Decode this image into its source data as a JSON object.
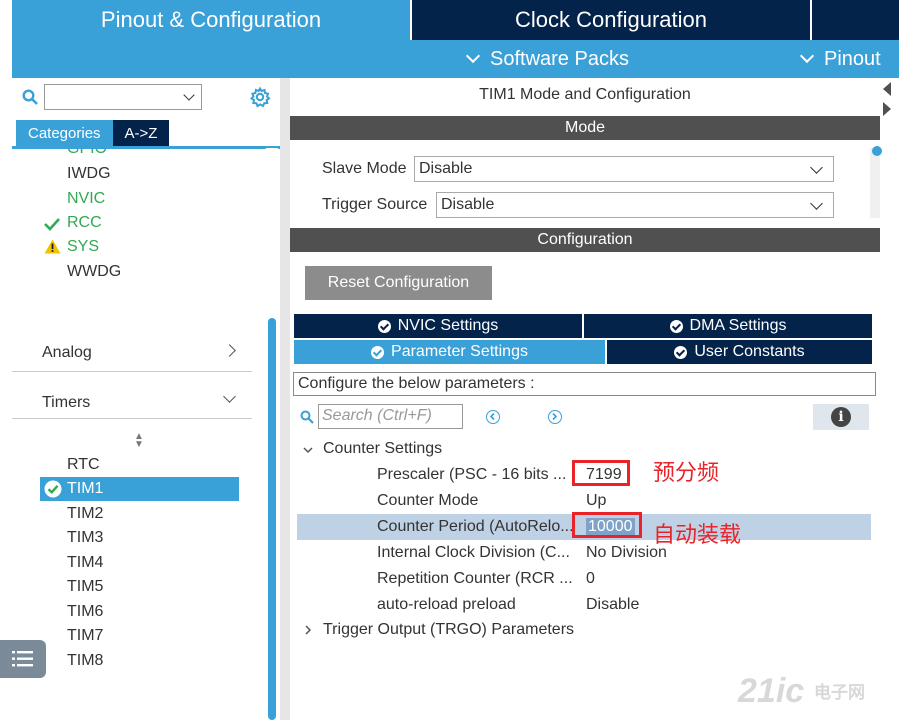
{
  "top_tabs": {
    "pinout_config": "Pinout & Configuration",
    "clock_config": "Clock Configuration"
  },
  "sub_bar": {
    "software_packs": "Software Packs",
    "pinout": "Pinout"
  },
  "sidebar": {
    "tabs": [
      "Categories",
      "A->Z"
    ],
    "system_core_items": [
      {
        "label": "GPIO",
        "status": "partial"
      },
      {
        "label": "IWDG",
        "status": "none"
      },
      {
        "label": "NVIC",
        "status": "ok"
      },
      {
        "label": "RCC",
        "status": "ok-check"
      },
      {
        "label": "SYS",
        "status": "warning"
      },
      {
        "label": "WWDG",
        "status": "none"
      }
    ],
    "sections": [
      "Analog",
      "Timers"
    ],
    "timers_items": [
      "RTC",
      "TIM1",
      "TIM2",
      "TIM3",
      "TIM4",
      "TIM5",
      "TIM6",
      "TIM7",
      "TIM8"
    ],
    "selected_item": "TIM1"
  },
  "main": {
    "title": "TIM1 Mode and Configuration",
    "mode_header": "Mode",
    "slave_mode_label": "Slave Mode",
    "slave_mode_value": "Disable",
    "trigger_source_label": "Trigger Source",
    "trigger_source_value": "Disable",
    "config_header": "Configuration",
    "reset_button": "Reset Configuration",
    "config_tabs": [
      "NVIC Settings",
      "DMA Settings",
      "Parameter Settings",
      "User Constants"
    ],
    "active_tab": "Parameter Settings",
    "configure_text": "Configure the below parameters :",
    "search_placeholder": "Search (Ctrl+F)",
    "counter_settings_label": "Counter Settings",
    "params": [
      {
        "name": "Prescaler (PSC - 16 bits ...",
        "value": "7199"
      },
      {
        "name": "Counter Mode",
        "value": "Up"
      },
      {
        "name": "Counter Period (AutoRelo...",
        "value": "10000"
      },
      {
        "name": "Internal Clock Division (C...",
        "value": "No Division"
      },
      {
        "name": "Repetition Counter (RCR ...",
        "value": "0"
      },
      {
        "name": "auto-reload preload",
        "value": "Disable"
      }
    ],
    "trigger_output_label": "Trigger Output (TRGO) Parameters"
  },
  "annotations": {
    "prescaler_note": "预分频",
    "period_note": "自动装载"
  },
  "watermark": {
    "brand": "21ic",
    "cn": "电子网"
  },
  "colors": {
    "accent": "#3aa0d8",
    "navy": "#03234b",
    "header_grey": "#505050",
    "highlight_row": "#bfd1e5",
    "annotation_red": "#e8242a",
    "ok_green": "#34a853"
  }
}
